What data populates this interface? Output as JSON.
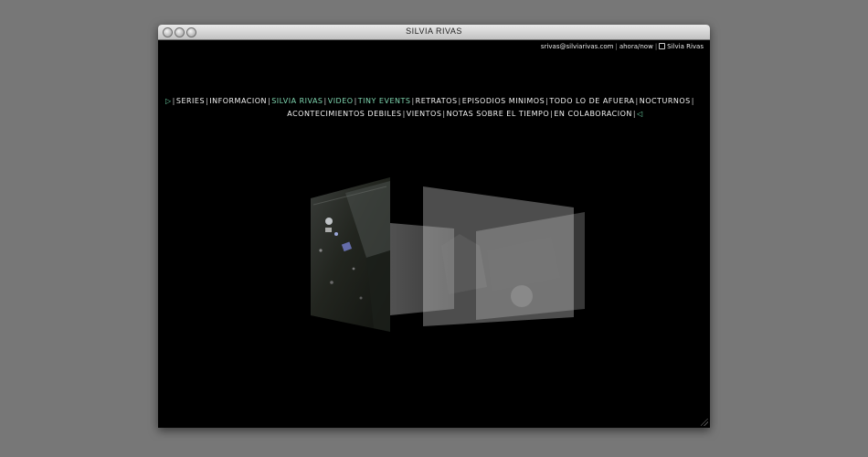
{
  "window": {
    "title": "SILVIA RIVAS"
  },
  "toplinks": {
    "email": "srivas@silviarivas.com",
    "ahora": "ahora/now",
    "copyright_name": "Silvia Rivas"
  },
  "nav": {
    "row1": [
      {
        "label": "SERIES",
        "color": "#f2f2f2"
      },
      {
        "label": "INFORMACION",
        "color": "#f2f2f2"
      },
      {
        "label": "SILVIA RIVAS",
        "color": "#7fd6b0"
      },
      {
        "label": "VIDEO",
        "color": "#7fd6b0"
      },
      {
        "label": "TINY EVENTS",
        "color": "#7fd6b0"
      },
      {
        "label": "RETRATOS",
        "color": "#f2f2f2"
      },
      {
        "label": "EPISODIOS MINIMOS",
        "color": "#f2f2f2"
      },
      {
        "label": "TODO LO DE AFUERA",
        "color": "#f2f2f2"
      },
      {
        "label": "NOCTURNOS",
        "color": "#f2f2f2"
      }
    ],
    "row2": [
      {
        "label": "ACONTECIMIENTOS DEBILES"
      },
      {
        "label": "VIENTOS"
      },
      {
        "label": "NOTAS SOBRE EL TIEMPO"
      },
      {
        "label": "EN COLABORACION"
      }
    ]
  },
  "colors": {
    "accent_green": "#7fd6b0",
    "background": "#000000",
    "desktop": "#777777"
  }
}
